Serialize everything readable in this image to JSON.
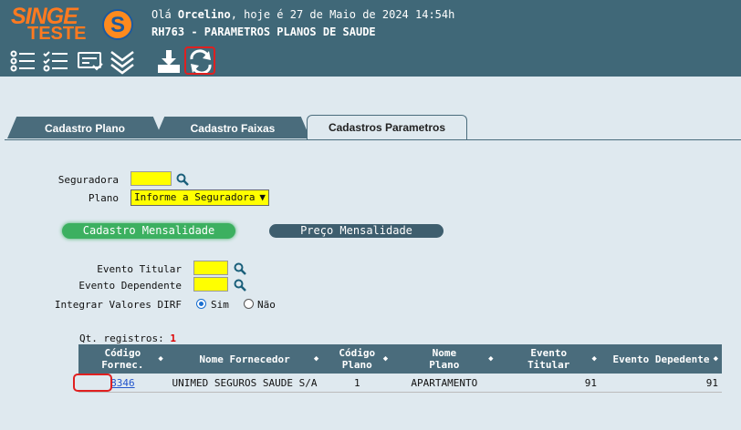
{
  "app": {
    "logo_text": "SINGE",
    "logo_subtext": "TESTE",
    "logo_mark": "S",
    "greeting_prefix": "Olá ",
    "user": "Orcelino",
    "greeting_suffix": ", hoje é 27 de Maio de 2024 14:54h",
    "page_title": "RH763 - PARAMETROS PLANOS DE SAUDE"
  },
  "toolbar": {
    "icons": [
      "list-icon",
      "checklist-icon",
      "card-icon",
      "chevrons-down-icon",
      "download-icon",
      "refresh-icon"
    ]
  },
  "tabs": [
    {
      "label": "Cadastro Plano",
      "active": false
    },
    {
      "label": "Cadastro Faixas",
      "active": false
    },
    {
      "label": "Cadastros Parametros",
      "active": true
    }
  ],
  "form": {
    "seguradora_label": "Seguradora",
    "seguradora_value": "",
    "plano_label": "Plano",
    "plano_selected": "Informe a Seguradora",
    "btn_cadastro_mensalidade": "Cadastro Mensalidade",
    "btn_preco_mensalidade": "Preço Mensalidade",
    "evento_titular_label": "Evento Titular",
    "evento_titular_value": "",
    "evento_dependente_label": "Evento Dependente",
    "evento_dependente_value": "",
    "integrar_label": "Integrar Valores DIRF",
    "opt_sim": "Sim",
    "opt_nao": "Não",
    "selected_option": "Sim"
  },
  "grid": {
    "qt_label": "Qt. registros:",
    "qt_value": "1",
    "columns": [
      {
        "line1": "Código",
        "line2": "Fornec."
      },
      {
        "line1": "Nome Fornecedor",
        "line2": ""
      },
      {
        "line1": "Código",
        "line2": "Plano"
      },
      {
        "line1": "Nome",
        "line2": "Plano"
      },
      {
        "line1": "Evento",
        "line2": "Titular"
      },
      {
        "line1": "Evento Depedente",
        "line2": ""
      }
    ],
    "rows": [
      {
        "cod_fornec": "8346",
        "nome_fornecedor": "UNIMED SEGUROS SAUDE S/A",
        "cod_plano": "1",
        "nome_plano": "APARTAMENTO",
        "evento_titular": "91",
        "evento_dependente": "91"
      }
    ]
  },
  "colors": {
    "header_bg": "#406878",
    "brand_orange": "#ff7a20",
    "input_yellow": "#ffff00",
    "accent_green": "#3cb060",
    "highlight_red": "#e02020"
  }
}
